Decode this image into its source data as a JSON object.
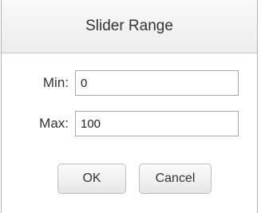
{
  "dialog": {
    "title": "Slider Range",
    "min": {
      "label": "Min:",
      "value": "0"
    },
    "max": {
      "label": "Max:",
      "value": "100"
    },
    "buttons": {
      "ok": "OK",
      "cancel": "Cancel"
    }
  }
}
